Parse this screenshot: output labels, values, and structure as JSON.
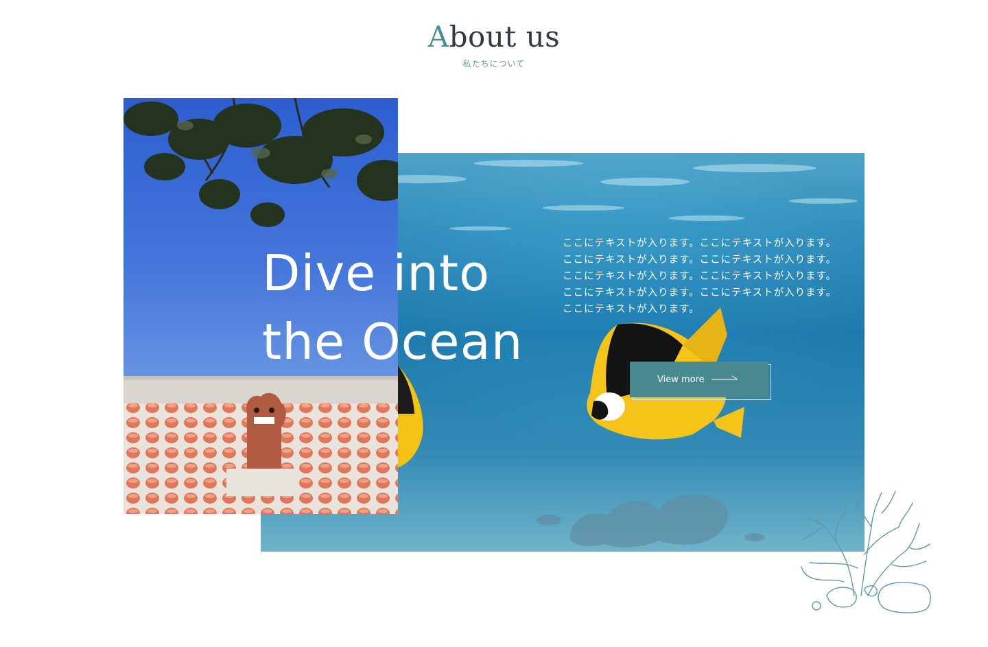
{
  "section": {
    "title_first_letter": "A",
    "title_rest": "bout us",
    "subtitle": "私たちについて"
  },
  "hero": {
    "headline_line1": "Dive into",
    "headline_line2": "the Ocean",
    "paragraph1": "ここにテキストが入ります。ここにテキストが入ります。ここにテキストが入ります。ここにテキストが入ります。",
    "paragraph2": "ここにテキストが入ります。ここにテキストが入ります。ここにテキストが入ります。ここにテキストが入ります。ここにテキストが入ります。",
    "button_label": "View more"
  },
  "images": {
    "left": "okinawa-shisa-roof-photo",
    "right": "underwater-butterflyfish-photo",
    "decoration": "coral-line-icon"
  },
  "colors": {
    "accent": "#47898f",
    "title_accent": "#4a8f97",
    "coral_stroke": "#5c9aa7"
  }
}
